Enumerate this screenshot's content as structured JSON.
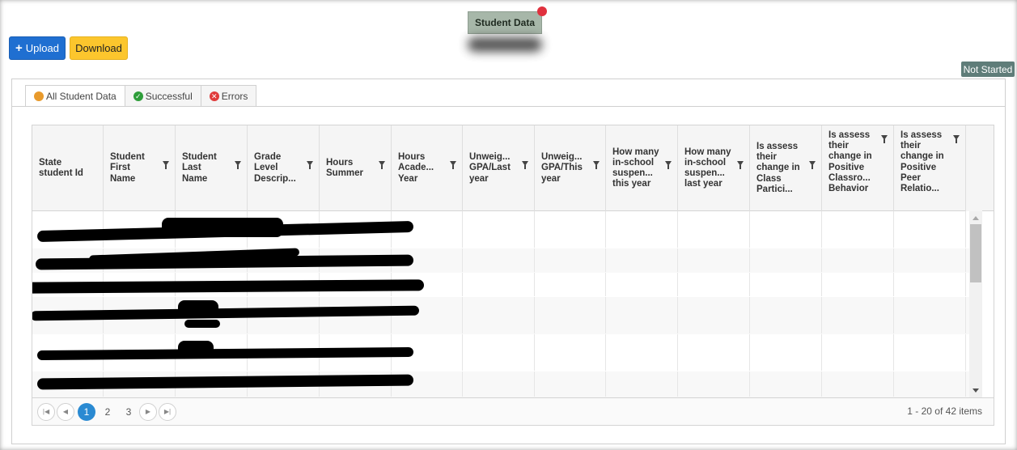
{
  "header": {
    "title": "Student Data"
  },
  "toolbar": {
    "upload_label": "Upload",
    "download_label": "Download"
  },
  "status": {
    "label": "Not Started"
  },
  "tabs": [
    {
      "label": "All Student Data",
      "icon": "globe-icon"
    },
    {
      "label": "Successful",
      "icon": "check-icon"
    },
    {
      "label": "Errors",
      "icon": "error-icon"
    }
  ],
  "grid": {
    "columns": [
      "State student Id",
      "Student First Name",
      "Student Last Name",
      "Grade Level Descrip...",
      "Hours Summer",
      "Hours Acade... Year",
      "Unweig... GPA/Last year",
      "Unweig... GPA/This year",
      "How many in-school suspen... this year",
      "How many in-school suspen... last year",
      "Is assess their change in Class Partici...",
      "Is assess their change in Positive Classro... Behavior",
      "Is assess their change in Positive Peer Relatio..."
    ]
  },
  "pager": {
    "pages": [
      "1",
      "2",
      "3"
    ],
    "current": "1",
    "info": "1 - 20 of 42 items"
  },
  "colors": {
    "upload": "#1f6fd1",
    "download": "#fcc62d",
    "status_badge": "#5f7d79",
    "title_chip": "#a7b7a9",
    "notification_dot": "#e0313e",
    "active_page": "#2a8ad2"
  }
}
